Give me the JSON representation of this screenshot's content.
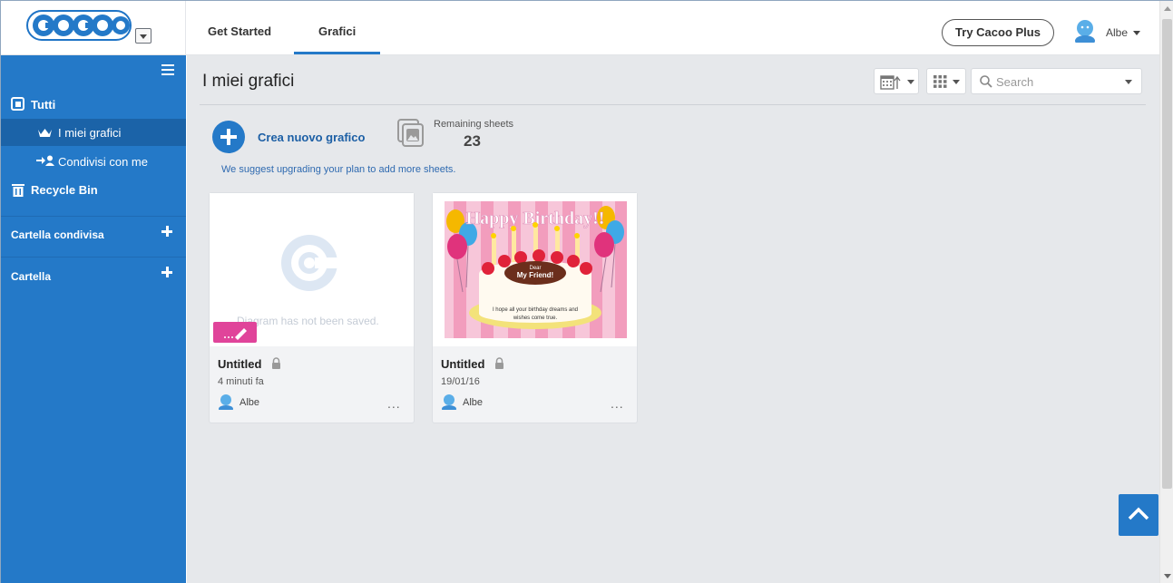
{
  "header": {
    "logo_text": "Cacoo",
    "tabs": [
      {
        "label": "Get Started"
      },
      {
        "label": "Grafici"
      }
    ],
    "try_button": "Try Cacoo Plus",
    "user_name": "Albe"
  },
  "sidebar": {
    "items": [
      {
        "label": "Tutti",
        "icon": "folder-all-icon"
      },
      {
        "label": "I miei grafici",
        "icon": "crown-icon"
      },
      {
        "label": "Condivisi con me",
        "icon": "shared-user-icon"
      },
      {
        "label": "Recycle Bin",
        "icon": "trash-icon"
      }
    ],
    "sections": [
      {
        "label": "Cartella condivisa"
      },
      {
        "label": "Cartella"
      }
    ]
  },
  "main": {
    "title": "I miei grafici",
    "search_placeholder": "Search",
    "create_label": "Crea nuovo grafico",
    "remaining_label": "Remaining sheets",
    "remaining_count": "23",
    "suggest_text": "We suggest upgrading your plan to add more sheets."
  },
  "cards": [
    {
      "title": "Untitled",
      "date": "4 minuti fa",
      "owner": "Albe",
      "placeholder_text": "Diagram has not been saved.",
      "more": "..."
    },
    {
      "title": "Untitled",
      "date": "19/01/16",
      "owner": "Albe",
      "thumb_heading": "Happy Birthday!!",
      "thumb_cake_line1": "Dear",
      "thumb_cake_line2": "My Friend!",
      "thumb_wish_line1": "I hope all your birthday dreams and",
      "thumb_wish_line2": "wishes come true.",
      "more": "..."
    }
  ],
  "colors": {
    "accent": "#2479c8",
    "sidebar_active": "#1b63a8",
    "edit_badge": "#e0449a"
  }
}
